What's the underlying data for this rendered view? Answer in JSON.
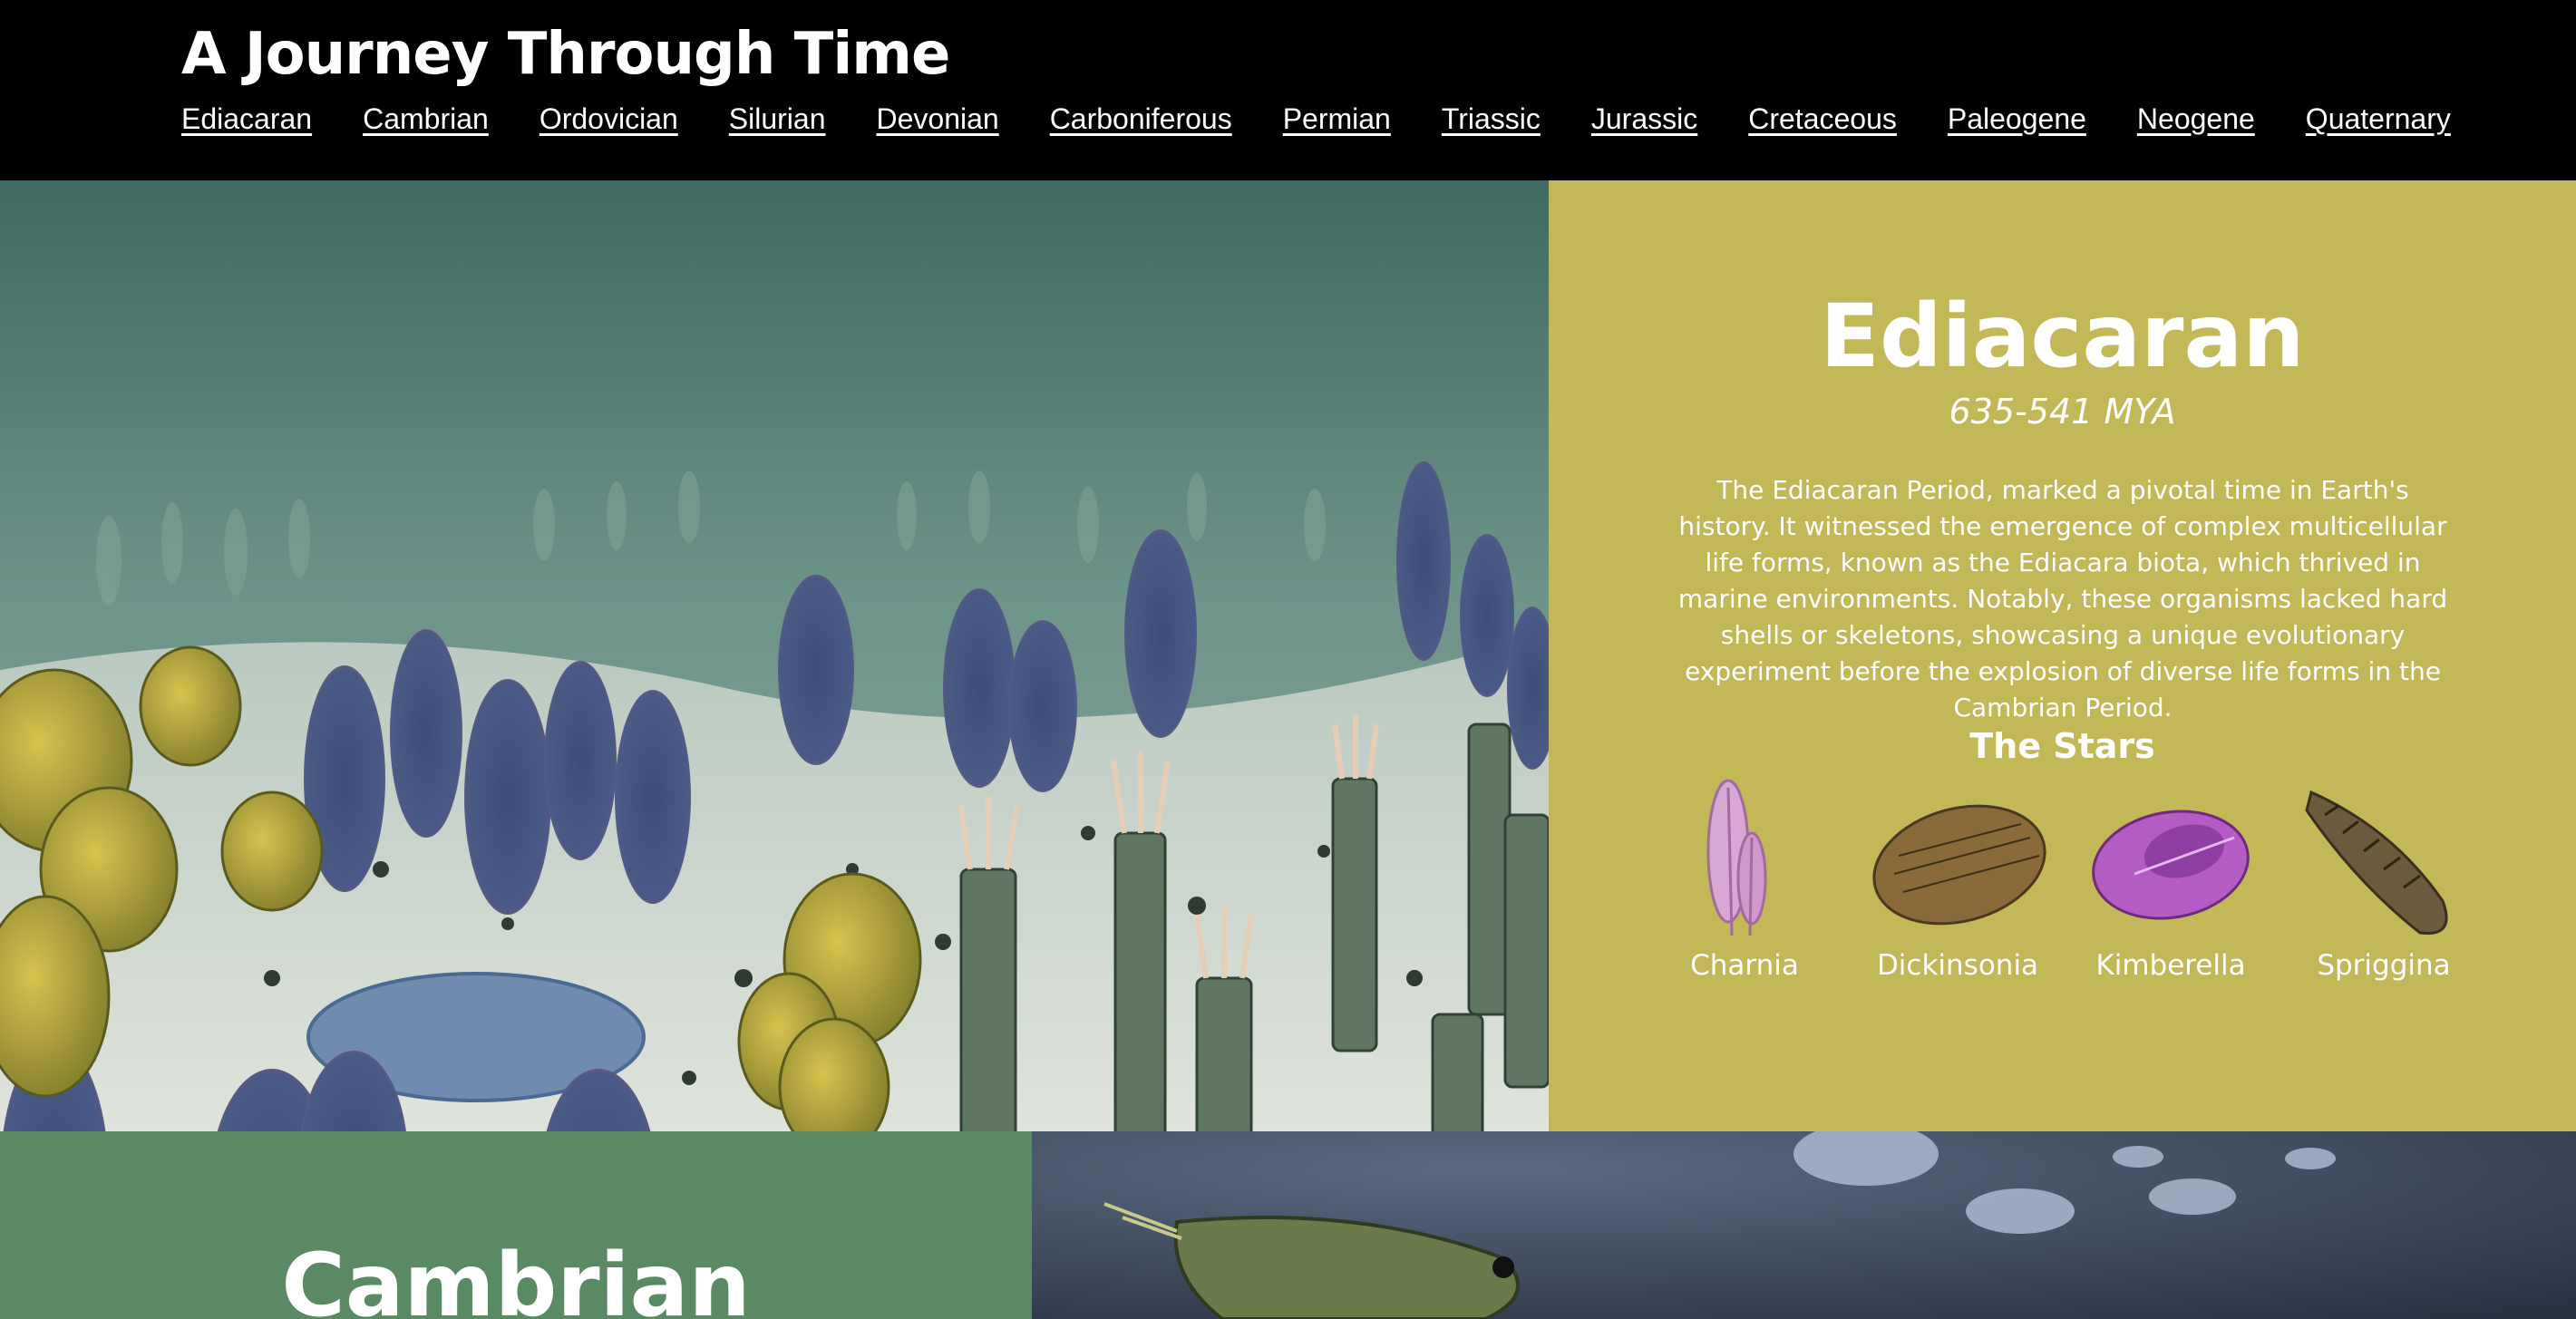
{
  "site": {
    "title": "A Journey Through Time"
  },
  "nav": {
    "items": [
      {
        "label": "Ediacaran"
      },
      {
        "label": "Cambrian"
      },
      {
        "label": "Ordovician"
      },
      {
        "label": "Silurian"
      },
      {
        "label": "Devonian"
      },
      {
        "label": "Carboniferous"
      },
      {
        "label": "Permian"
      },
      {
        "label": "Triassic"
      },
      {
        "label": "Jurassic"
      },
      {
        "label": "Cretaceous"
      },
      {
        "label": "Paleogene"
      },
      {
        "label": "Neogene"
      },
      {
        "label": "Quaternary"
      }
    ]
  },
  "ediacaran": {
    "name": "Ediacaran",
    "range": "635-541 MYA",
    "description": "The Ediacaran Period, marked a pivotal time in Earth's history. It witnessed the emergence of complex multicellular life forms, known as the Ediacara biota, which thrived in marine environments. Notably, these organisms lacked hard shells or skeletons, showcasing a unique evolutionary experiment before the explosion of diverse life forms in the Cambrian Period.",
    "stars_title": "The Stars",
    "stars": [
      {
        "name": "Charnia",
        "icon": "charnia-icon"
      },
      {
        "name": "Dickinsonia",
        "icon": "dickinsonia-icon"
      },
      {
        "name": "Kimberella",
        "icon": "kimberella-icon"
      },
      {
        "name": "Spriggina",
        "icon": "spriggina-icon"
      }
    ],
    "panel_color": "#c3b857"
  },
  "cambrian": {
    "name": "Cambrian",
    "panel_color": "#5a8a63"
  }
}
